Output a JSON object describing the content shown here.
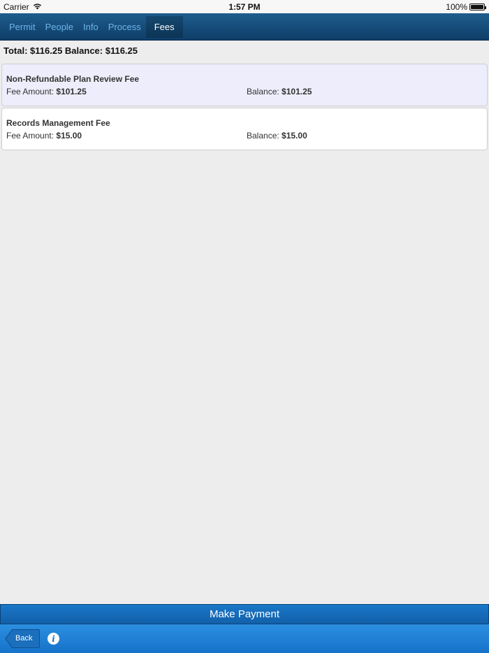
{
  "status_bar": {
    "carrier": "Carrier",
    "time": "1:57 PM",
    "battery": "100%"
  },
  "tabs": [
    {
      "label": "Permit",
      "active": false
    },
    {
      "label": "People",
      "active": false
    },
    {
      "label": "Info",
      "active": false
    },
    {
      "label": "Process",
      "active": false
    },
    {
      "label": "Fees",
      "active": true
    }
  ],
  "totals": {
    "text": "Total: $116.25 Balance: $116.25"
  },
  "fees": [
    {
      "name": "Non-Refundable Plan Review Fee",
      "amount_label": "Fee Amount:",
      "amount": "$101.25",
      "balance_label": "Balance:",
      "balance": "$101.25",
      "highlighted": true
    },
    {
      "name": "Records Management Fee",
      "amount_label": "Fee Amount:",
      "amount": "$15.00",
      "balance_label": "Balance:",
      "balance": "$15.00",
      "highlighted": false
    }
  ],
  "actions": {
    "make_payment": "Make Payment",
    "back": "Back",
    "info_icon": "i"
  },
  "colors": {
    "tab_bar": "#0e3e68",
    "accent_blue": "#1a77c8",
    "highlight_row": "#ededfb"
  }
}
